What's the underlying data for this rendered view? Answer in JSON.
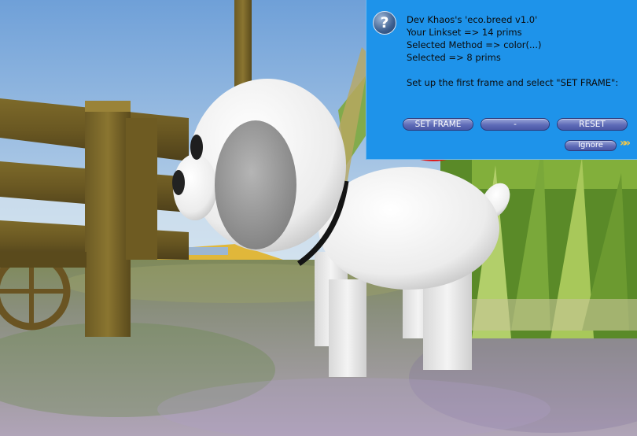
{
  "dialog": {
    "lines": [
      "Dev Khaos's 'eco.breed v1.0'",
      "Your Linkset => 14 prims",
      "Selected Method => color(...)",
      "Selected => 8 prims",
      "Set up the first frame and select \"SET FRAME\":"
    ],
    "help_icon_glyph": "?",
    "buttons": {
      "set_frame": "SET FRAME",
      "dash": "-",
      "reset": "RESET",
      "ignore": "Ignore"
    },
    "chevron_glyph": "»»"
  },
  "colors": {
    "dialog_bg": "#1e93ea",
    "button": "#5f6cb8",
    "highlight_circle": "#e01010"
  }
}
